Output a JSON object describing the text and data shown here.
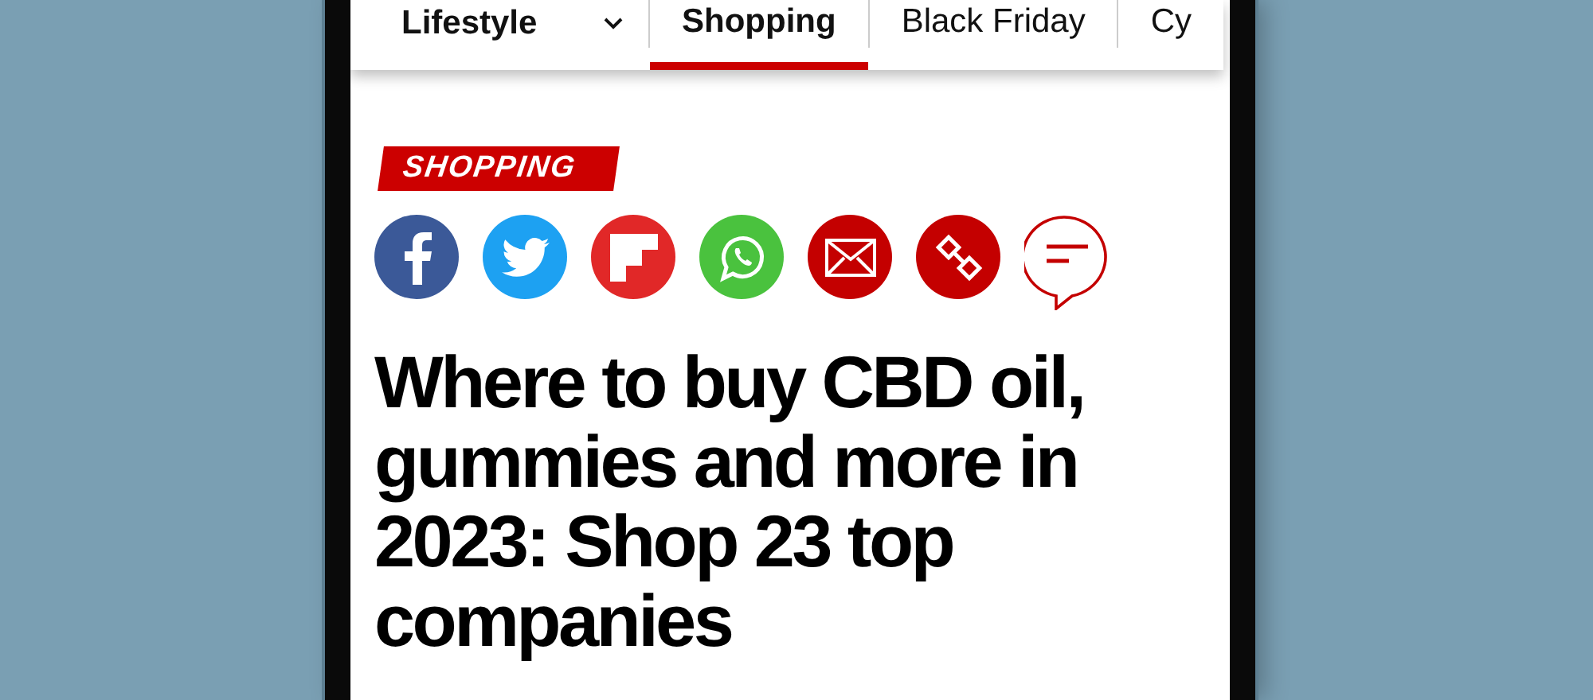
{
  "nav": {
    "menu": {
      "label": "Lifestyle"
    },
    "tabs": [
      {
        "label": "Shopping",
        "selected": true
      },
      {
        "label": "Black Friday",
        "selected": false
      },
      {
        "label": "Cy",
        "selected": false
      }
    ]
  },
  "article": {
    "category": "SHOPPING",
    "share": [
      {
        "kind": "facebook",
        "color": "#3b5998"
      },
      {
        "kind": "twitter",
        "color": "#1da1f2"
      },
      {
        "kind": "flipboard",
        "color": "#e12828"
      },
      {
        "kind": "whatsapp",
        "color": "#4ac23e"
      },
      {
        "kind": "email",
        "color": "#c40000"
      },
      {
        "kind": "link",
        "color": "#c40000"
      },
      {
        "kind": "comment",
        "color": "#c40000"
      }
    ],
    "headline": "Where to buy CBD oil,\ngummies and more in\n2023: Shop 23 top\ncompanies"
  }
}
